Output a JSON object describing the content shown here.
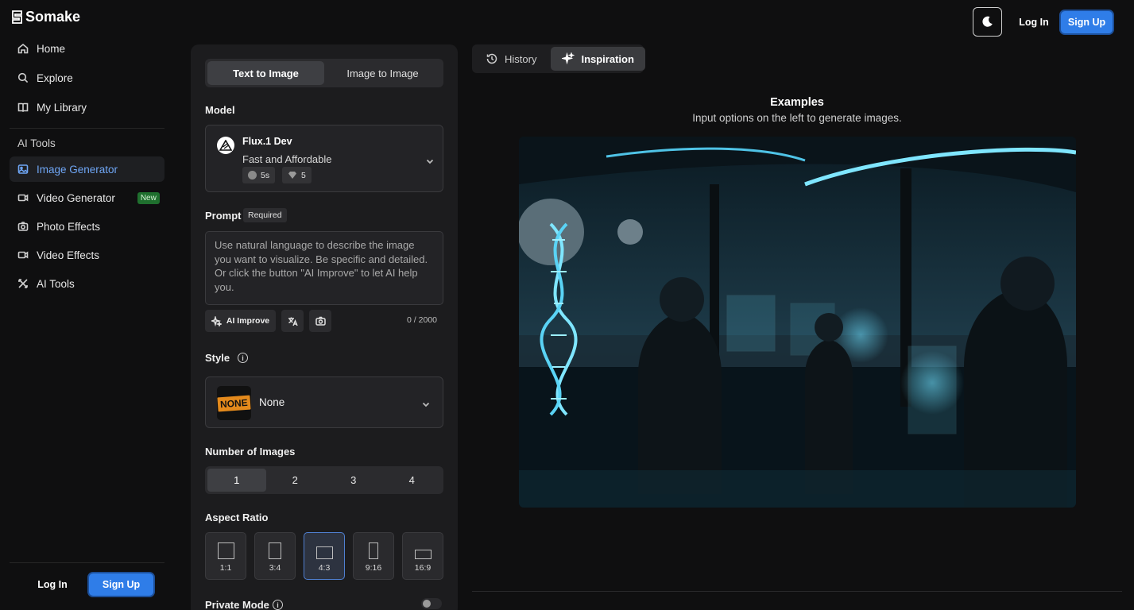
{
  "brand": {
    "name": "Somake"
  },
  "sidebar": {
    "items": [
      {
        "label": "Home",
        "icon": "home-icon"
      },
      {
        "label": "Explore",
        "icon": "search-icon"
      },
      {
        "label": "My Library",
        "icon": "book-icon"
      }
    ],
    "section_label": "AI Tools",
    "tools": [
      {
        "label": "Image Generator",
        "icon": "image-icon",
        "active": true
      },
      {
        "label": "Video Generator",
        "icon": "video-icon",
        "badge": "New"
      },
      {
        "label": "Photo Effects",
        "icon": "camera-icon"
      },
      {
        "label": "Video Effects",
        "icon": "video-icon"
      },
      {
        "label": "AI Tools",
        "icon": "tools-icon"
      }
    ],
    "login": "Log In",
    "signup": "Sign Up"
  },
  "panel": {
    "tabs": [
      "Text to Image",
      "Image to Image"
    ],
    "active_tab": "Text to Image",
    "model_label": "Model",
    "model": {
      "name": "Flux.1 Dev",
      "desc": "Fast and Affordable",
      "time": "5s",
      "credits": "5"
    },
    "prompt_label": "Prompt",
    "required": "Required",
    "prompt_placeholder": "Use natural language to describe the image you want to visualize. Be specific and detailed. Or click the button \"AI Improve\" to let AI help you.",
    "ai_improve": "AI Improve",
    "counter": "0 / 2000",
    "style_label": "Style",
    "style": {
      "name": "None",
      "thumb_text": "NONE"
    },
    "count_label": "Number of Images",
    "counts": [
      "1",
      "2",
      "3",
      "4"
    ],
    "selected_count": "1",
    "aspect_label": "Aspect Ratio",
    "ratios": [
      "1:1",
      "3:4",
      "4:3",
      "9:16",
      "16:9"
    ],
    "selected_ratio": "4:3",
    "private_label": "Private Mode",
    "private_mode": false
  },
  "main": {
    "tabs": [
      {
        "label": "History",
        "icon": "history-icon"
      },
      {
        "label": "Inspiration",
        "icon": "sparkle-icon"
      }
    ],
    "active_tab": "Inspiration",
    "examples_title": "Examples",
    "examples_sub": "Input options on the left to generate images."
  },
  "topbar": {
    "login": "Log In",
    "signup": "Sign Up",
    "theme_icon": "moon-icon"
  },
  "colors": {
    "accent": "#2f7de8",
    "active_nav": "#6fa6f5",
    "badge_new": "#1f6f2e"
  }
}
